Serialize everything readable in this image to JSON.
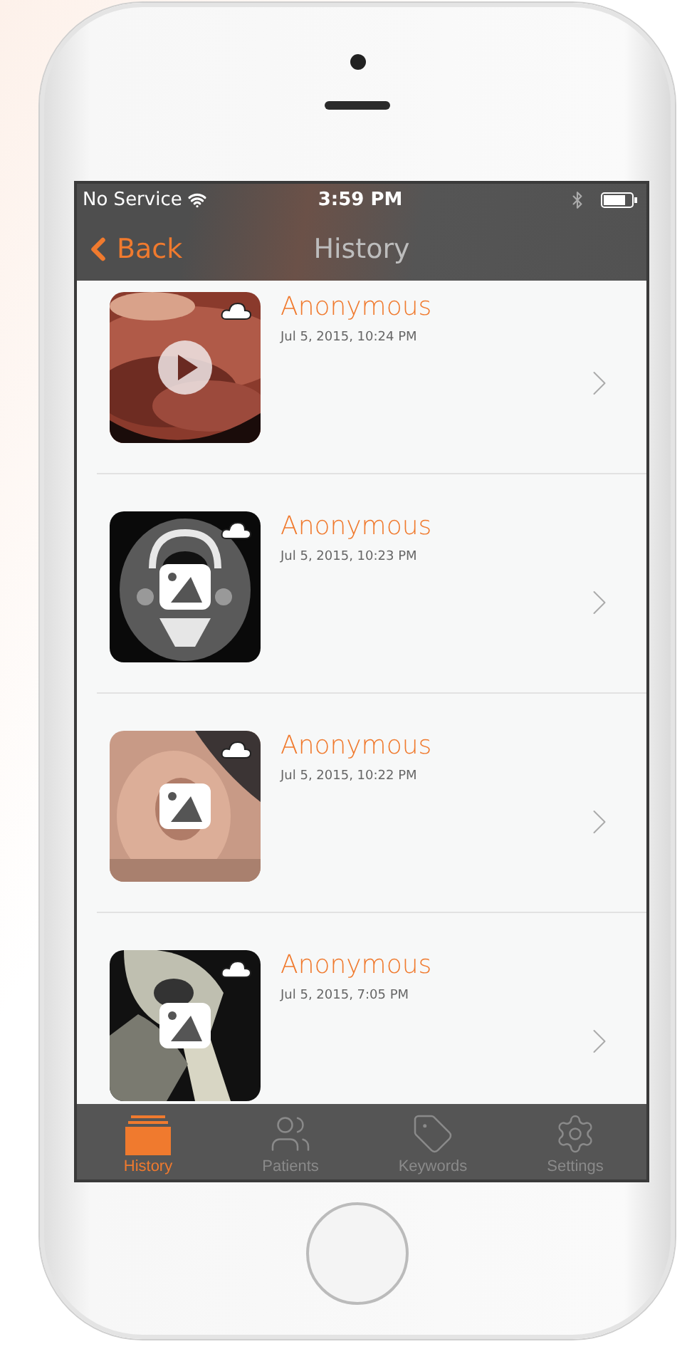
{
  "status_bar": {
    "carrier": "No Service",
    "time": "3:59 PM"
  },
  "nav": {
    "back": "Back",
    "title": "History"
  },
  "records": [
    {
      "name": "Anonymous",
      "date": "Jul 5, 2015, 10:24 PM",
      "kind": "video"
    },
    {
      "name": "Anonymous",
      "date": "Jul 5, 2015, 10:23 PM"
    },
    {
      "name": "Anonymous",
      "date": "Jul 5, 2015, 10:22 PM"
    },
    {
      "name": "Anonymous",
      "date": "Jul 5, 2015, 7:05 PM"
    }
  ],
  "tabs": [
    {
      "label": "History",
      "selected": true
    },
    {
      "label": "Patients",
      "selected": false
    },
    {
      "label": "Keywords",
      "selected": false
    },
    {
      "label": "Settings",
      "selected": false
    }
  ]
}
